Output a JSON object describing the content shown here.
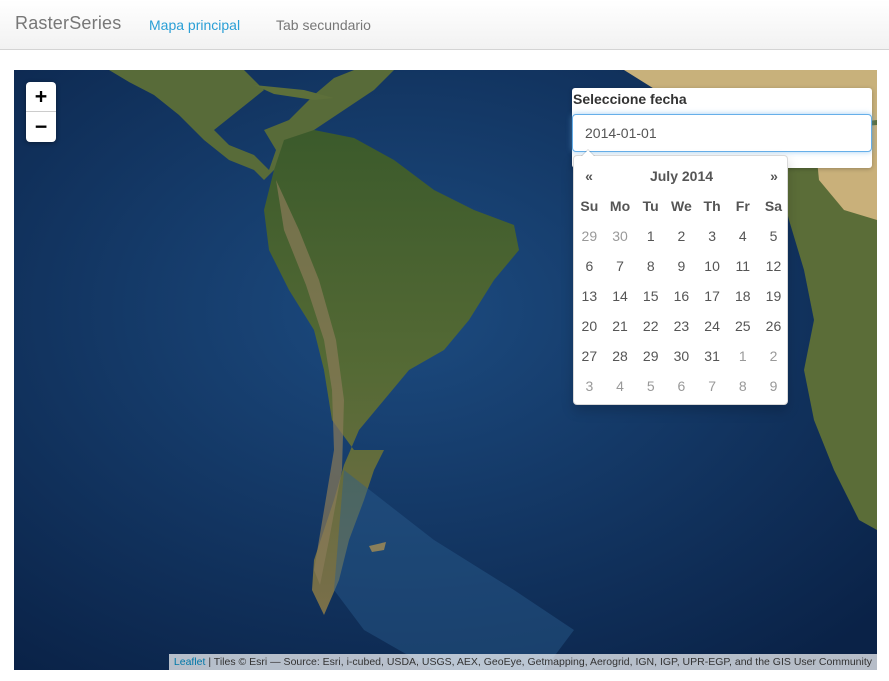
{
  "navbar": {
    "brand": "RasterSeries",
    "tabs": [
      {
        "label": "Mapa principal",
        "active": true
      },
      {
        "label": "Tab secundario",
        "active": false
      }
    ]
  },
  "map": {
    "zoom_in": "+",
    "zoom_out": "−",
    "attribution_link": "Leaflet",
    "attribution_text": " | Tiles © Esri — Source: Esri, i-cubed, USDA, USGS, AEX, GeoEye, Getmapping, Aerogrid, IGN, IGP, UPR-EGP, and the GIS User Community"
  },
  "date_control": {
    "label": "Seleccione fecha",
    "value": "2014-01-01"
  },
  "datepicker": {
    "prev": "«",
    "next": "»",
    "month_year": "July 2014",
    "weekdays": [
      "Su",
      "Mo",
      "Tu",
      "We",
      "Th",
      "Fr",
      "Sa"
    ],
    "weeks": [
      [
        {
          "d": "29",
          "o": true
        },
        {
          "d": "30",
          "o": true
        },
        {
          "d": "1"
        },
        {
          "d": "2"
        },
        {
          "d": "3"
        },
        {
          "d": "4"
        },
        {
          "d": "5"
        }
      ],
      [
        {
          "d": "6"
        },
        {
          "d": "7"
        },
        {
          "d": "8"
        },
        {
          "d": "9"
        },
        {
          "d": "10"
        },
        {
          "d": "11"
        },
        {
          "d": "12"
        }
      ],
      [
        {
          "d": "13"
        },
        {
          "d": "14"
        },
        {
          "d": "15"
        },
        {
          "d": "16"
        },
        {
          "d": "17"
        },
        {
          "d": "18"
        },
        {
          "d": "19"
        }
      ],
      [
        {
          "d": "20"
        },
        {
          "d": "21"
        },
        {
          "d": "22"
        },
        {
          "d": "23"
        },
        {
          "d": "24"
        },
        {
          "d": "25"
        },
        {
          "d": "26"
        }
      ],
      [
        {
          "d": "27"
        },
        {
          "d": "28"
        },
        {
          "d": "29"
        },
        {
          "d": "30"
        },
        {
          "d": "31"
        },
        {
          "d": "1",
          "o": true
        },
        {
          "d": "2",
          "o": true
        }
      ],
      [
        {
          "d": "3",
          "o": true
        },
        {
          "d": "4",
          "o": true
        },
        {
          "d": "5",
          "o": true
        },
        {
          "d": "6",
          "o": true
        },
        {
          "d": "7",
          "o": true
        },
        {
          "d": "8",
          "o": true
        },
        {
          "d": "9",
          "o": true
        }
      ]
    ]
  },
  "colors": {
    "accent": "#2a9fd6",
    "ocean": "#0d2c57",
    "land": "#3d5a2a"
  }
}
